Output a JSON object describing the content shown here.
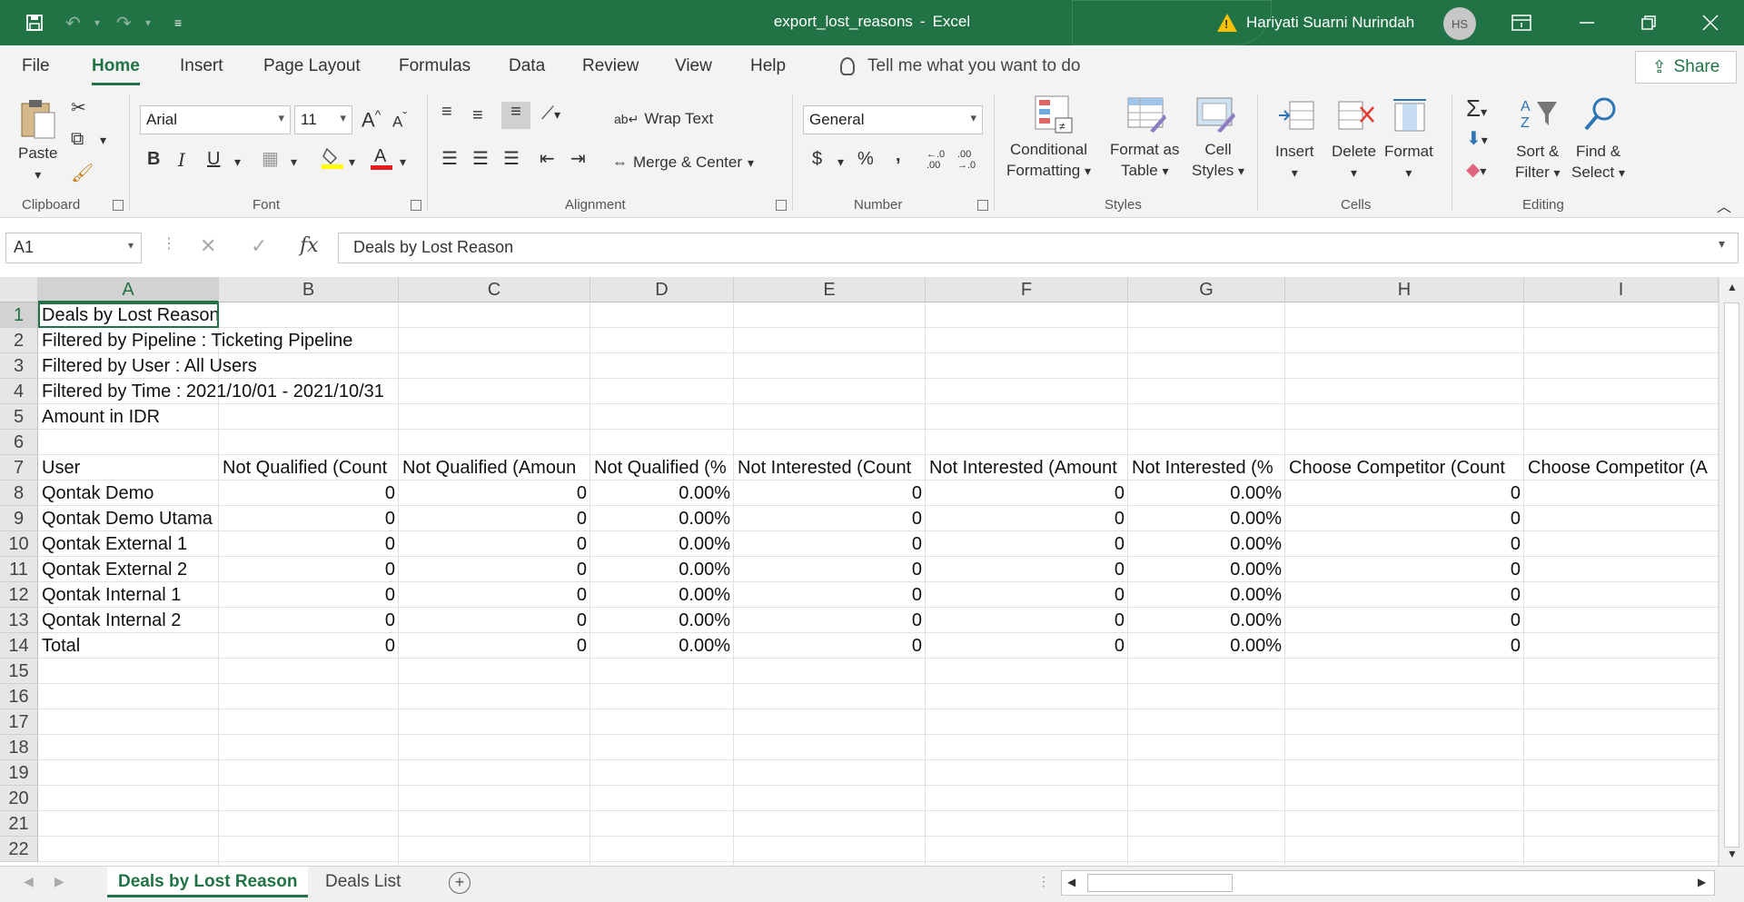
{
  "titlebar": {
    "filename": "export_lost_reasons",
    "separator": "-",
    "app": "Excel",
    "user_name": "Hariyati Suarni Nurindah",
    "user_initials": "HS"
  },
  "ribbon_tabs": [
    "File",
    "Home",
    "Insert",
    "Page Layout",
    "Formulas",
    "Data",
    "Review",
    "View",
    "Help"
  ],
  "active_tab": "Home",
  "tell_me": "Tell me what you want to do",
  "share_label": "Share",
  "clipboard": {
    "paste": "Paste",
    "group": "Clipboard"
  },
  "font": {
    "name": "Arial",
    "size": "11",
    "bold": "B",
    "italic": "I",
    "underline": "U",
    "group": "Font"
  },
  "alignment": {
    "wrap": "Wrap Text",
    "merge": "Merge & Center",
    "group": "Alignment"
  },
  "number": {
    "format": "General",
    "currency": "$",
    "percent": "%",
    "comma": ",",
    "inc_dec": "←.0\n.00",
    "dec_dec": ".00\n→.0",
    "group": "Number"
  },
  "styles": {
    "conditional": "Conditional",
    "conditional2": "Formatting",
    "format_as": "Format as",
    "format_as2": "Table",
    "cell": "Cell",
    "cell2": "Styles",
    "group": "Styles"
  },
  "cells": {
    "insert": "Insert",
    "delete": "Delete",
    "format": "Format",
    "group": "Cells"
  },
  "editing": {
    "sort": "Sort &",
    "sort2": "Filter",
    "find": "Find &",
    "find2": "Select",
    "group": "Editing"
  },
  "formula_bar": {
    "name_box": "A1",
    "content": "Deals by Lost Reason",
    "fx": "fx"
  },
  "columns": [
    "A",
    "B",
    "C",
    "D",
    "E",
    "F",
    "G",
    "H",
    "I"
  ],
  "rows": [
    "1",
    "2",
    "3",
    "4",
    "5",
    "6",
    "7",
    "8",
    "9",
    "10",
    "11",
    "12",
    "13",
    "14",
    "15",
    "16",
    "17",
    "18",
    "19",
    "20",
    "21",
    "22"
  ],
  "sheet": {
    "r1": "Deals by Lost Reason",
    "r2": "Filtered by Pipeline : Ticketing Pipeline",
    "r3": "Filtered by User : All Users",
    "r4": "Filtered by Time : 2021/10/01 - 2021/10/31",
    "r5": "Amount in IDR",
    "headers": [
      "User",
      "Not Qualified (Count",
      "Not Qualified (Amoun",
      "Not Qualified (%",
      "Not Interested (Count",
      "Not Interested (Amount",
      "Not Interested (%",
      "Choose Competitor (Count",
      "Choose Competitor (A"
    ],
    "data": [
      [
        "Qontak Demo",
        "0",
        "0",
        "0.00%",
        "0",
        "0",
        "0.00%",
        "0"
      ],
      [
        "Qontak Demo Utama",
        "0",
        "0",
        "0.00%",
        "0",
        "0",
        "0.00%",
        "0"
      ],
      [
        "Qontak External 1",
        "0",
        "0",
        "0.00%",
        "0",
        "0",
        "0.00%",
        "0"
      ],
      [
        "Qontak External 2",
        "0",
        "0",
        "0.00%",
        "0",
        "0",
        "0.00%",
        "0"
      ],
      [
        "Qontak Internal 1",
        "0",
        "0",
        "0.00%",
        "0",
        "0",
        "0.00%",
        "0"
      ],
      [
        "Qontak  Internal 2",
        "0",
        "0",
        "0.00%",
        "0",
        "0",
        "0.00%",
        "0"
      ],
      [
        "Total",
        "0",
        "0",
        "0.00%",
        "0",
        "0",
        "0.00%",
        "0"
      ]
    ]
  },
  "sheet_tabs": [
    "Deals by Lost Reason",
    "Deals List"
  ],
  "active_sheet": "Deals by Lost Reason",
  "colors": {
    "accent": "#217346",
    "warning": "#f7c300"
  }
}
